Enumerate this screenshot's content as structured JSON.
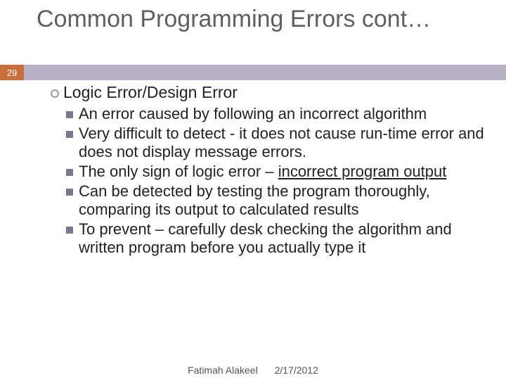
{
  "title": "Common Programming Errors cont…",
  "page_number": "29",
  "heading": "Logic Error/Design Error",
  "bullets": {
    "b1": "An error caused by following an incorrect algorithm",
    "b2": "Very difficult to detect - it does not cause run-time error and does not display message errors.",
    "b3a": "The only sign of logic error – ",
    "b3b": "incorrect program output",
    "b4": "Can be detected by testing the program thoroughly, comparing its output to calculated results",
    "b5": "To prevent – carefully desk checking the algorithm and written program before you actually type it"
  },
  "footer": {
    "author": "Fatimah Alakeel",
    "date": "2/17/2012"
  }
}
